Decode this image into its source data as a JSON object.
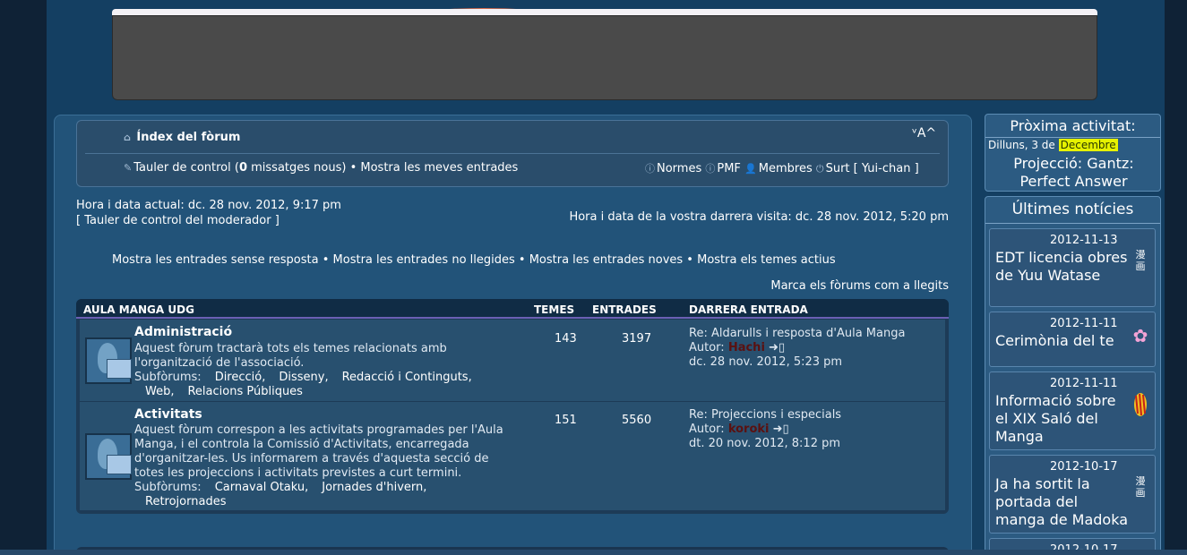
{
  "nav": {
    "index_label": "Índex del fòrum",
    "font_size_label": "ᵛA^",
    "ucp_label": "Tauler de control (",
    "unread_count": "0",
    "ucp_suffix": " missatges nous)",
    "bullet": " • ",
    "my_posts_label": "Mostra les meves entrades",
    "rules_label": "Normes",
    "faq_label": "PMF",
    "members_label": "Membres",
    "logout_label": "Surt [ Yui-chan ]"
  },
  "times": {
    "current": "Hora i data actual: dc. 28 nov. 2012, 9:17 pm",
    "mcp": "[ Tauler de control del moderador ]",
    "last_visit": "Hora i data de la vostra darrera visita: dc. 28 nov. 2012, 5:20 pm"
  },
  "search_links": {
    "unanswered": "Mostra les entrades sense resposta",
    "unread": "Mostra les entrades no llegides",
    "new_posts": "Mostra les entrades noves",
    "active": "Mostra els temes actius",
    "separator": " • "
  },
  "mark_read": "Marca els fòrums com a llegits",
  "table": {
    "category": "AULA MANGA UDG",
    "col_topics": "TEMES",
    "col_posts": "ENTRADES",
    "col_last": "DARRERA ENTRADA",
    "forums": [
      {
        "title": "Administració",
        "desc1": "Aquest fòrum tractarà tots els temes relacionats amb",
        "desc2": "l'organització de l'associació.",
        "sub_label": "Subfòrums:",
        "subs": [
          "Direcció,",
          "Disseny,",
          "Redacció i Continguts,",
          "Web,",
          "Relacions Públiques"
        ],
        "topics": "143",
        "posts": "3197",
        "last_title": "Re: Aldarulls i resposta d'Aula Manga",
        "last_author_label": "Autor:",
        "last_author": "Hachi",
        "last_date": "dc. 28 nov. 2012, 5:23 pm"
      },
      {
        "title": "Activitats",
        "desc1": "Aquest fòrum correspon a les activitats programades per l'Aula",
        "desc2": "Manga, i el controla la Comissió d'Activitats, encarregada",
        "desc3": "d'organitzar-les. Us informarem a través d'aquesta secció de",
        "desc4": "totes les projeccions i activitats previstes a curt termini.",
        "sub_label": "Subfòrums:",
        "subs": [
          "Carnaval Otaku,",
          "Jornades d'hivern,",
          "Retrojornades"
        ],
        "topics": "151",
        "posts": "5560",
        "last_title": "Re: Projeccions i especials",
        "last_author_label": "Autor:",
        "last_author": "koroki",
        "last_date": "dt. 20 nov. 2012, 8:12 pm"
      }
    ]
  },
  "sidebar": {
    "next_title": "Pròxima activitat:",
    "next_date_prefix": "Dilluns, 3 de ",
    "next_date_month": "Decembre",
    "next_text": "Projecció: Gantz: Perfect Answer",
    "news_title": "Últimes notícies",
    "news": [
      {
        "date": "2012-11-13",
        "title": "EDT licencia obres de Yuu Watase",
        "icon": "漫画"
      },
      {
        "date": "2012-11-11",
        "title": "Cerimònia del te",
        "icon": "flower-icon"
      },
      {
        "date": "2012-11-11",
        "title": "Informació sobre el XIX Saló del Manga",
        "icon": "flag-icon"
      },
      {
        "date": "2012-10-17",
        "title": "Ja ha sortit la portada del manga de Madoka",
        "icon": "漫画"
      },
      {
        "date": "2012-10-17",
        "title": "",
        "icon": ""
      }
    ]
  },
  "colors": {
    "background": "#143f62",
    "panel": "#225379",
    "highlight": "#e6f200",
    "author": "#5a1111"
  }
}
